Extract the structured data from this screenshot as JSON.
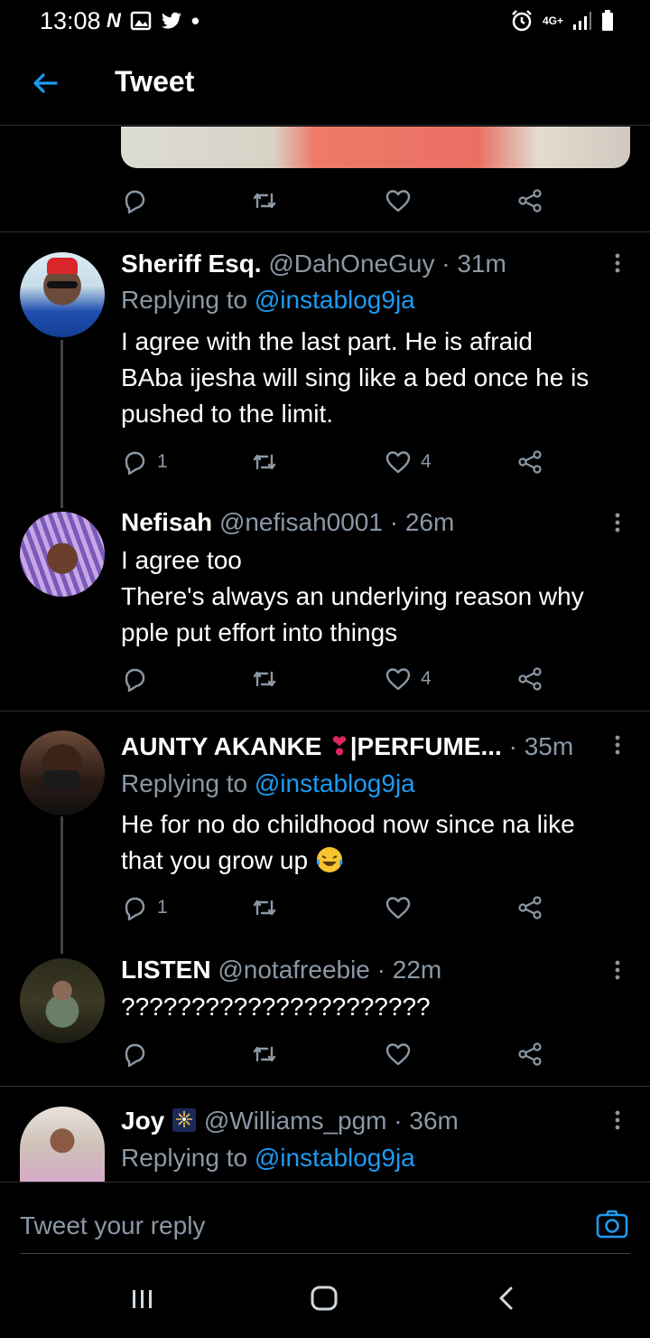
{
  "status_bar": {
    "time": "13:08",
    "network": "4G+",
    "icons": [
      "n-icon",
      "image-icon",
      "twitter-bird-icon",
      "dot-icon",
      "alarm-icon",
      "signal-icon",
      "battery-icon"
    ]
  },
  "header": {
    "title": "Tweet",
    "back_icon": "arrow-left-icon"
  },
  "colors": {
    "accent": "#1d9bf0",
    "muted": "#8b98a5",
    "divider": "#2f3336",
    "background": "#000000"
  },
  "tweets": [
    {
      "name": "Sheriff Esq.",
      "handle": "@DahOneGuy",
      "sep": "·",
      "time": "31m",
      "reply_prefix": "Replying to",
      "reply_to": "@instablog9ja",
      "text": "I agree with the last part. He is afraid\nBAba ijesha will sing like a bed once he is\npushed to the limit.",
      "reply_count": "1",
      "retweet_count": "",
      "like_count": "4"
    },
    {
      "name": "Nefisah",
      "handle": "@nefisah0001",
      "sep": "·",
      "time": "26m",
      "text": "I agree too\nThere's always an underlying reason why\npple put effort into things",
      "reply_count": "",
      "retweet_count": "",
      "like_count": "4"
    },
    {
      "name": "AUNTY AKANKE",
      "name_emoji": "❣",
      "name_suffix": "|PERFUME...",
      "sep": "·",
      "time": "35m",
      "reply_prefix": "Replying to",
      "reply_to": "@instablog9ja",
      "text": "He for no do childhood now since na like\nthat you grow up",
      "reply_count": "1",
      "retweet_count": "",
      "like_count": ""
    },
    {
      "name": "LISTEN",
      "handle": "@notafreebie",
      "sep": "·",
      "time": "22m",
      "text": "??????????????????????",
      "reply_count": "",
      "retweet_count": "",
      "like_count": ""
    },
    {
      "name": "Joy",
      "handle": "@Williams_pgm",
      "sep": "·",
      "time": "36m",
      "reply_prefix": "Replying to",
      "reply_to": "@instablog9ja"
    }
  ],
  "composer": {
    "placeholder": "Tweet your reply",
    "camera_icon": "camera-icon"
  },
  "nav": {
    "icons": [
      "recent-apps-icon",
      "home-icon",
      "back-icon"
    ]
  }
}
